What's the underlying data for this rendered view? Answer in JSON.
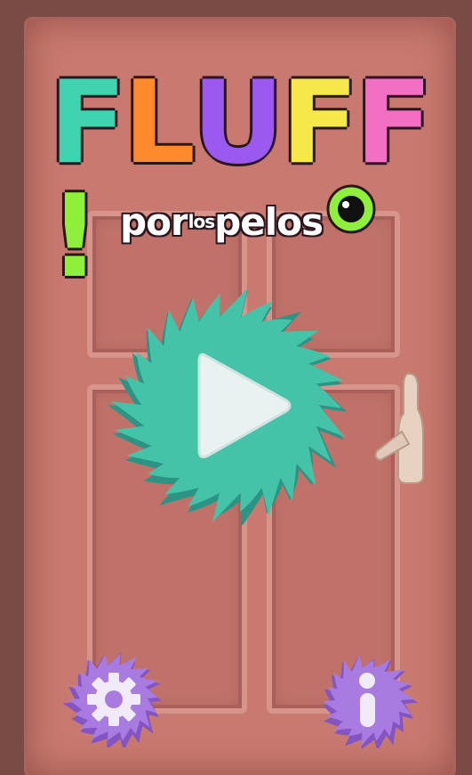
{
  "game": {
    "title_letters": [
      {
        "char": "F",
        "color": "#3fd3b0"
      },
      {
        "char": "L",
        "color": "#ff8a2e"
      },
      {
        "char": "U",
        "color": "#9b59f0"
      },
      {
        "char": "F",
        "color": "#f6e84a"
      },
      {
        "char": "F",
        "color": "#f36fc4"
      },
      {
        "char": "!",
        "color": "#8ef03a"
      }
    ],
    "subtitle": {
      "part1": "por",
      "part2": "los",
      "part3": "pelos"
    }
  },
  "buttons": {
    "play": {
      "icon": "play-icon",
      "color": "#45c3a9",
      "shadow": "#2c9484"
    },
    "settings": {
      "icon": "gear-icon",
      "color": "#a77be0",
      "shadow": "#8454c3"
    },
    "info": {
      "icon": "info-icon",
      "color": "#a77be0",
      "shadow": "#8454c3"
    }
  },
  "colors": {
    "door": "#c97a70",
    "frame": "#7a4a44",
    "eye": "#8ef03a"
  }
}
